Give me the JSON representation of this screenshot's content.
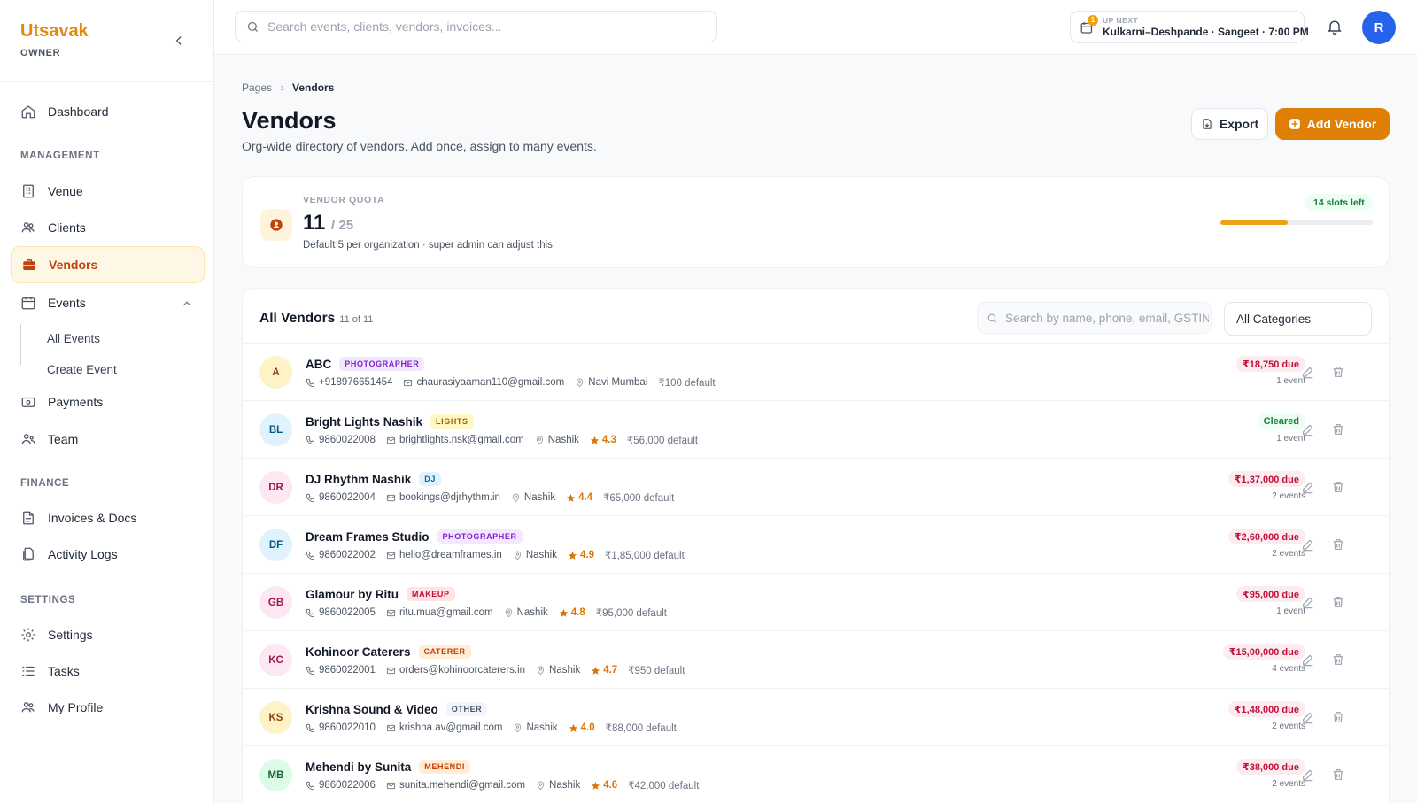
{
  "brand": {
    "name": "Utsavak",
    "role": "OWNER"
  },
  "nav": {
    "dashboard": "Dashboard",
    "management_heading": "MANAGEMENT",
    "venue": "Venue",
    "clients": "Clients",
    "vendors": "Vendors",
    "events": "Events",
    "all_events": "All Events",
    "create_event": "Create Event",
    "payments": "Payments",
    "team": "Team",
    "finance_heading": "FINANCE",
    "invoices": "Invoices & Docs",
    "activity_logs": "Activity Logs",
    "settings_heading": "SETTINGS",
    "settings": "Settings",
    "tasks": "Tasks",
    "my_profile": "My Profile"
  },
  "topbar": {
    "search_placeholder": "Search events, clients, vendors, invoices...",
    "up_next_label": "UP NEXT",
    "up_next_badge": "1",
    "up_next_text": "Kulkarni–Deshpande · Sangeet · 7:00 PM",
    "avatar_initial": "R"
  },
  "breadcrumb": {
    "root": "Pages",
    "current": "Vendors"
  },
  "page": {
    "title": "Vendors",
    "subtitle": "Org-wide directory of vendors. Add once, assign to many events.",
    "export_label": "Export",
    "add_label": "Add Vendor"
  },
  "quota": {
    "label": "VENDOR QUOTA",
    "used": "11",
    "total": "/ 25",
    "note": "Default 5 per organization · super admin can adjust this.",
    "slots_left": "14 slots left",
    "fill_fraction": 0.44
  },
  "list": {
    "title": "All Vendors",
    "count": "11 of 11",
    "search_placeholder": "Search by name, phone, email, GSTIN",
    "category_value": "All Categories"
  },
  "colors": {
    "accent": "#df7f06",
    "due_text": "#be123c",
    "cleared_text": "#15803d"
  },
  "vendors": [
    {
      "initials": "A",
      "name": "ABC",
      "category": "PHOTOGRAPHER",
      "phone": "+918976651454",
      "email": "chaurasiyaaman110@gmail.com",
      "city": "Navi Mumbai",
      "rating": "",
      "default": "₹100 default",
      "status": "₹18,750 due",
      "status_type": "due",
      "events": "1 event",
      "avatar_bg": "#fef3c7",
      "avatar_fg": "#92400e",
      "tag_bg": "#f3e8ff",
      "tag_fg": "#7e22ce"
    },
    {
      "initials": "BL",
      "name": "Bright Lights Nashik",
      "category": "LIGHTS",
      "phone": "9860022008",
      "email": "brightlights.nsk@gmail.com",
      "city": "Nashik",
      "rating": "4.3",
      "default": "₹56,000 default",
      "status": "Cleared",
      "status_type": "cleared",
      "events": "1 event",
      "avatar_bg": "#e0f2fe",
      "avatar_fg": "#075985",
      "tag_bg": "#fef9c3",
      "tag_fg": "#a16207"
    },
    {
      "initials": "DR",
      "name": "DJ Rhythm Nashik",
      "category": "DJ",
      "phone": "9860022004",
      "email": "bookings@djrhythm.in",
      "city": "Nashik",
      "rating": "4.4",
      "default": "₹65,000 default",
      "status": "₹1,37,000 due",
      "status_type": "due",
      "events": "2 events",
      "avatar_bg": "#fce7f3",
      "avatar_fg": "#9d174d",
      "tag_bg": "#e0f2fe",
      "tag_fg": "#0369a1"
    },
    {
      "initials": "DF",
      "name": "Dream Frames Studio",
      "category": "PHOTOGRAPHER",
      "phone": "9860022002",
      "email": "hello@dreamframes.in",
      "city": "Nashik",
      "rating": "4.9",
      "default": "₹1,85,000 default",
      "status": "₹2,60,000 due",
      "status_type": "due",
      "events": "2 events",
      "avatar_bg": "#e0f2fe",
      "avatar_fg": "#075985",
      "tag_bg": "#f3e8ff",
      "tag_fg": "#7e22ce"
    },
    {
      "initials": "GB",
      "name": "Glamour by Ritu",
      "category": "MAKEUP",
      "phone": "9860022005",
      "email": "ritu.mua@gmail.com",
      "city": "Nashik",
      "rating": "4.8",
      "default": "₹95,000 default",
      "status": "₹95,000 due",
      "status_type": "due",
      "events": "1 event",
      "avatar_bg": "#fce7f3",
      "avatar_fg": "#9d174d",
      "tag_bg": "#ffe4e6",
      "tag_fg": "#be123c"
    },
    {
      "initials": "KC",
      "name": "Kohinoor Caterers",
      "category": "CATERER",
      "phone": "9860022001",
      "email": "orders@kohinoorcaterers.in",
      "city": "Nashik",
      "rating": "4.7",
      "default": "₹950 default",
      "status": "₹15,00,000 due",
      "status_type": "due",
      "events": "4 events",
      "avatar_bg": "#fce7f3",
      "avatar_fg": "#9d174d",
      "tag_bg": "#ffedd5",
      "tag_fg": "#c2410c"
    },
    {
      "initials": "KS",
      "name": "Krishna Sound & Video",
      "category": "OTHER",
      "phone": "9860022010",
      "email": "krishna.av@gmail.com",
      "city": "Nashik",
      "rating": "4.0",
      "default": "₹88,000 default",
      "status": "₹1,48,000 due",
      "status_type": "due",
      "events": "2 events",
      "avatar_bg": "#fef3c7",
      "avatar_fg": "#92400e",
      "tag_bg": "#f1f5f9",
      "tag_fg": "#475569"
    },
    {
      "initials": "MB",
      "name": "Mehendi by Sunita",
      "category": "MEHENDI",
      "phone": "9860022006",
      "email": "sunita.mehendi@gmail.com",
      "city": "Nashik",
      "rating": "4.6",
      "default": "₹42,000 default",
      "status": "₹38,000 due",
      "status_type": "due",
      "events": "2 events",
      "avatar_bg": "#dcfce7",
      "avatar_fg": "#166534",
      "tag_bg": "#ffedd5",
      "tag_fg": "#c2410c"
    }
  ]
}
